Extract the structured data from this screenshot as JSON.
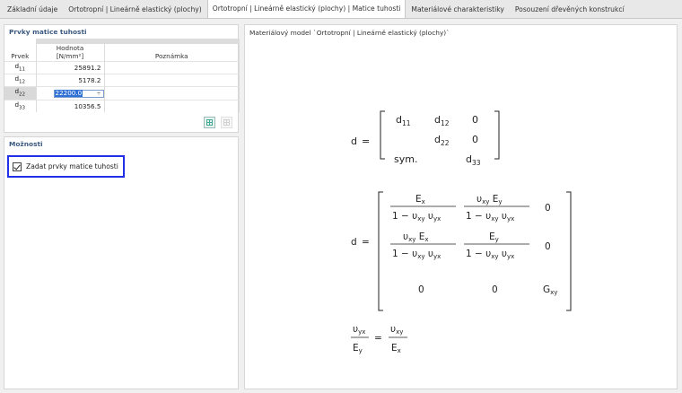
{
  "tabs": [
    {
      "label": "Základní údaje",
      "active": false
    },
    {
      "label": "Ortotropní | Lineárně elastický (plochy)",
      "active": false
    },
    {
      "label": "Ortotropní | Lineárně elastický (plochy) | Matice tuhosti",
      "active": true
    },
    {
      "label": "Materiálové charakteristiky",
      "active": false
    },
    {
      "label": "Posouzení dřevěných konstrukcí",
      "active": false
    }
  ],
  "stiffness_panel": {
    "title": "Prvky matice tuhosti",
    "columns": {
      "element": "Prvek",
      "value": "Hodnota",
      "value_unit": "[N/mm²]",
      "note": "Poznámka"
    },
    "rows": [
      {
        "sym": "d",
        "sub": "11",
        "value": "25891.2",
        "note": ""
      },
      {
        "sym": "d",
        "sub": "12",
        "value": "5178.2",
        "note": ""
      },
      {
        "sym": "d",
        "sub": "22",
        "value": "22200.0",
        "note": "",
        "editing": true
      },
      {
        "sym": "d",
        "sub": "33",
        "value": "10356.5",
        "note": ""
      }
    ],
    "icons": [
      "table-export-icon",
      "table-import-icon"
    ]
  },
  "options_panel": {
    "title": "Možnosti",
    "checkbox_label": "Zadat prvky matice tuhosti",
    "checked": true
  },
  "model_panel": {
    "title": "Materiálový model `Ortotropní | Lineárně elastický (plochy)`",
    "matrix1": {
      "lhs": "d",
      "eq": "=",
      "cells": [
        [
          "d",
          "11",
          "d",
          "12",
          "0"
        ],
        [
          "",
          "",
          "d",
          "22",
          "0"
        ],
        [
          "sym.",
          "",
          "",
          "",
          "d",
          "33"
        ]
      ]
    },
    "matrix2": {
      "lhs": "d",
      "eq": "=",
      "num_11": "E",
      "num_11_sub": "x",
      "den_common": "1 − υ",
      "num_12": "υ",
      "num_12_sub": "xy",
      "num_12_tail": "E",
      "num_12_tail_sub": "y",
      "num_21": "υ",
      "num_21_sub": "xy",
      "num_21_tail": "E",
      "num_21_tail_sub": "x",
      "num_22": "E",
      "num_22_sub": "y",
      "zero": "0",
      "g": "G",
      "g_sub": "xy"
    },
    "relation": {
      "lnum": "υ",
      "lnum_sub": "yx",
      "lden": "E",
      "lden_sub": "y",
      "eq": "=",
      "rnum": "υ",
      "rnum_sub": "xy",
      "rden": "E",
      "rden_sub": "x"
    }
  }
}
